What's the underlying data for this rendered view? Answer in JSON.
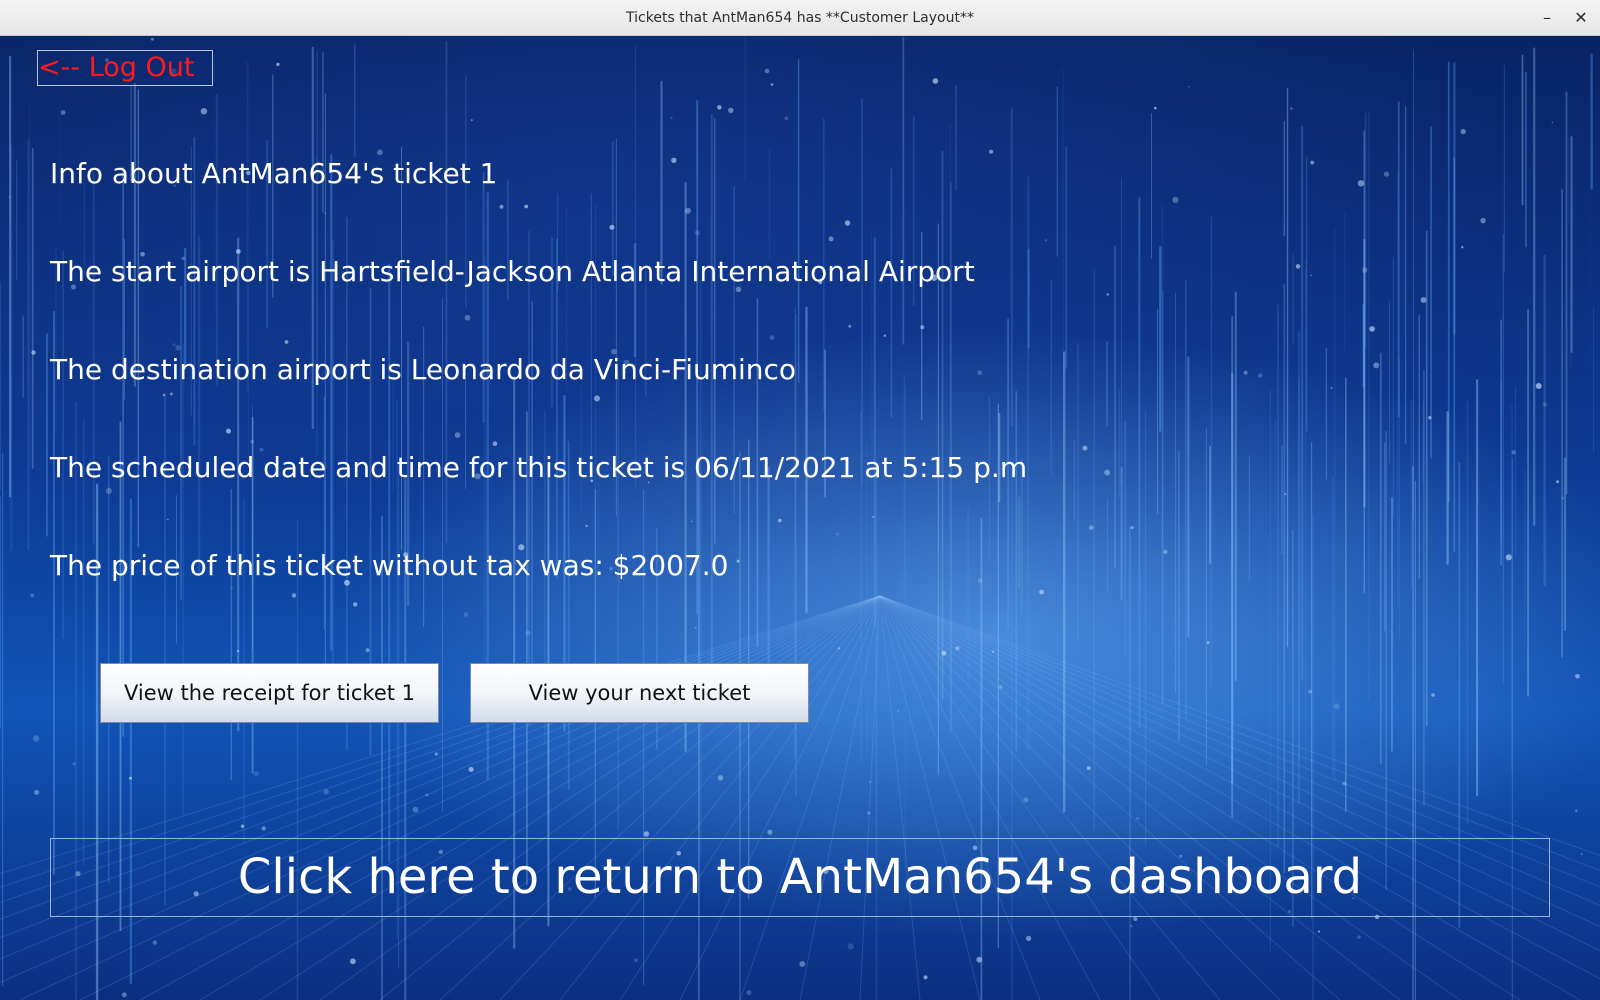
{
  "window": {
    "title": "Tickets that AntMan654 has  **Customer Layout**",
    "minimize_glyph": "–",
    "close_glyph": "✕"
  },
  "logout": {
    "label": "<-- Log Out",
    "color": "#ff1a1a"
  },
  "ticket": {
    "heading": "Info about AntMan654's ticket 1",
    "start_airport": "The start airport is Hartsfield-Jackson Atlanta International Airport",
    "destination_airport": "The destination airport is Leonardo da Vinci-Fiuminco",
    "schedule": " The scheduled date and time for this ticket is 06/11/2021 at 5:15 p.m",
    "price": "The price of this ticket without tax was: $2007.0"
  },
  "buttons": {
    "receipt_label": "View the receipt for ticket 1",
    "next_label": "View your next ticket"
  },
  "dashboard": {
    "label": "Click here to return to AntMan654's dashboard"
  },
  "colors": {
    "background": "#0d3a93",
    "text": "#ffffff"
  }
}
